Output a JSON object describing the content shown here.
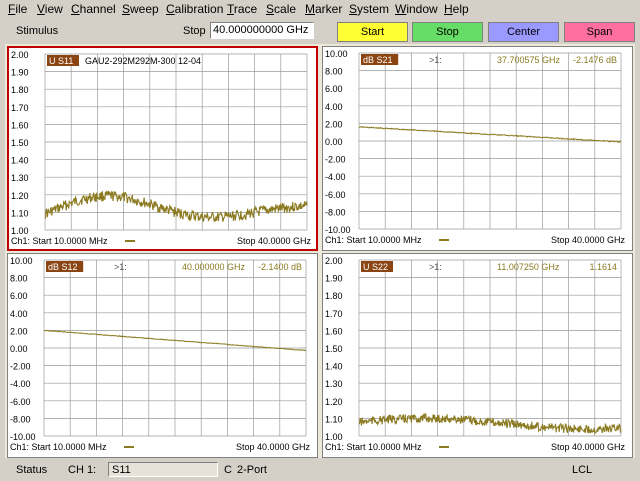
{
  "menu": [
    "File",
    "View",
    "Channel",
    "Sweep",
    "Calibration",
    "Trace",
    "Scale",
    "Marker",
    "System",
    "Window",
    "Help"
  ],
  "toolbar": {
    "stimulus_label": "Stimulus",
    "stop_label": "Stop",
    "stop_value": "40.000000000 GHz",
    "buttons": [
      {
        "label": "Start",
        "color": "#ffff33"
      },
      {
        "label": "Stop",
        "color": "#66dd66"
      },
      {
        "label": "Center",
        "color": "#9999ff"
      },
      {
        "label": "Span",
        "color": "#ff6fa0"
      }
    ]
  },
  "colors": {
    "trace": "#8b7a20",
    "grid": "#9a9a9a",
    "badge": "#8b4513",
    "active_border": "#c00000"
  },
  "panels": [
    {
      "id": "s11",
      "badge": "U S11",
      "annotation": "GAU2-292M292M-300 12-04",
      "marker_label": "",
      "marker_freq": "",
      "marker_value": "",
      "yticks": [
        "2.00",
        "1.90",
        "1.80",
        "1.70",
        "1.60",
        "1.50",
        "1.40",
        "1.30",
        "1.20",
        "1.10",
        "1.00"
      ],
      "footer_left": "Ch1: Start  10.0000 MHz",
      "footer_right": "Stop  40.0000 GHz",
      "active": true
    },
    {
      "id": "s21",
      "badge": "dB S21",
      "annotation": "",
      "marker_label": ">1:",
      "marker_freq": "37.700575 GHz",
      "marker_value": "-2.1476 dB",
      "yticks": [
        "10.00",
        "8.00",
        "6.00",
        "4.00",
        "2.00",
        "0.00",
        "-2.00",
        "-4.00",
        "-6.00",
        "-8.00",
        "-10.00"
      ],
      "footer_left": "Ch1: Start  10.0000 MHz",
      "footer_right": "Stop  40.0000 GHz",
      "active": false
    },
    {
      "id": "s12",
      "badge": "dB S12",
      "annotation": "",
      "marker_label": ">1:",
      "marker_freq": "40.000000 GHz",
      "marker_value": "-2.1400 dB",
      "yticks": [
        "10.00",
        "8.00",
        "6.00",
        "4.00",
        "2.00",
        "0.00",
        "-2.00",
        "-4.00",
        "-6.00",
        "-8.00",
        "-10.00"
      ],
      "footer_left": "Ch1: Start  10.0000 MHz",
      "footer_right": "Stop  40.0000 GHz",
      "active": false
    },
    {
      "id": "s22",
      "badge": "U S22",
      "annotation": "",
      "marker_label": ">1:",
      "marker_freq": "11.007250 GHz",
      "marker_value": "1.1614",
      "yticks": [
        "2.00",
        "1.90",
        "1.80",
        "1.70",
        "1.60",
        "1.50",
        "1.40",
        "1.30",
        "1.20",
        "1.10",
        "1.00"
      ],
      "footer_left": "Ch1: Start  10.0000 MHz",
      "footer_right": "Stop  40.0000 GHz",
      "active": false
    }
  ],
  "status": {
    "label": "Status",
    "channel": "CH 1:",
    "param": "S11",
    "cal": "C",
    "port": "2-Port",
    "mode": "LCL"
  }
}
